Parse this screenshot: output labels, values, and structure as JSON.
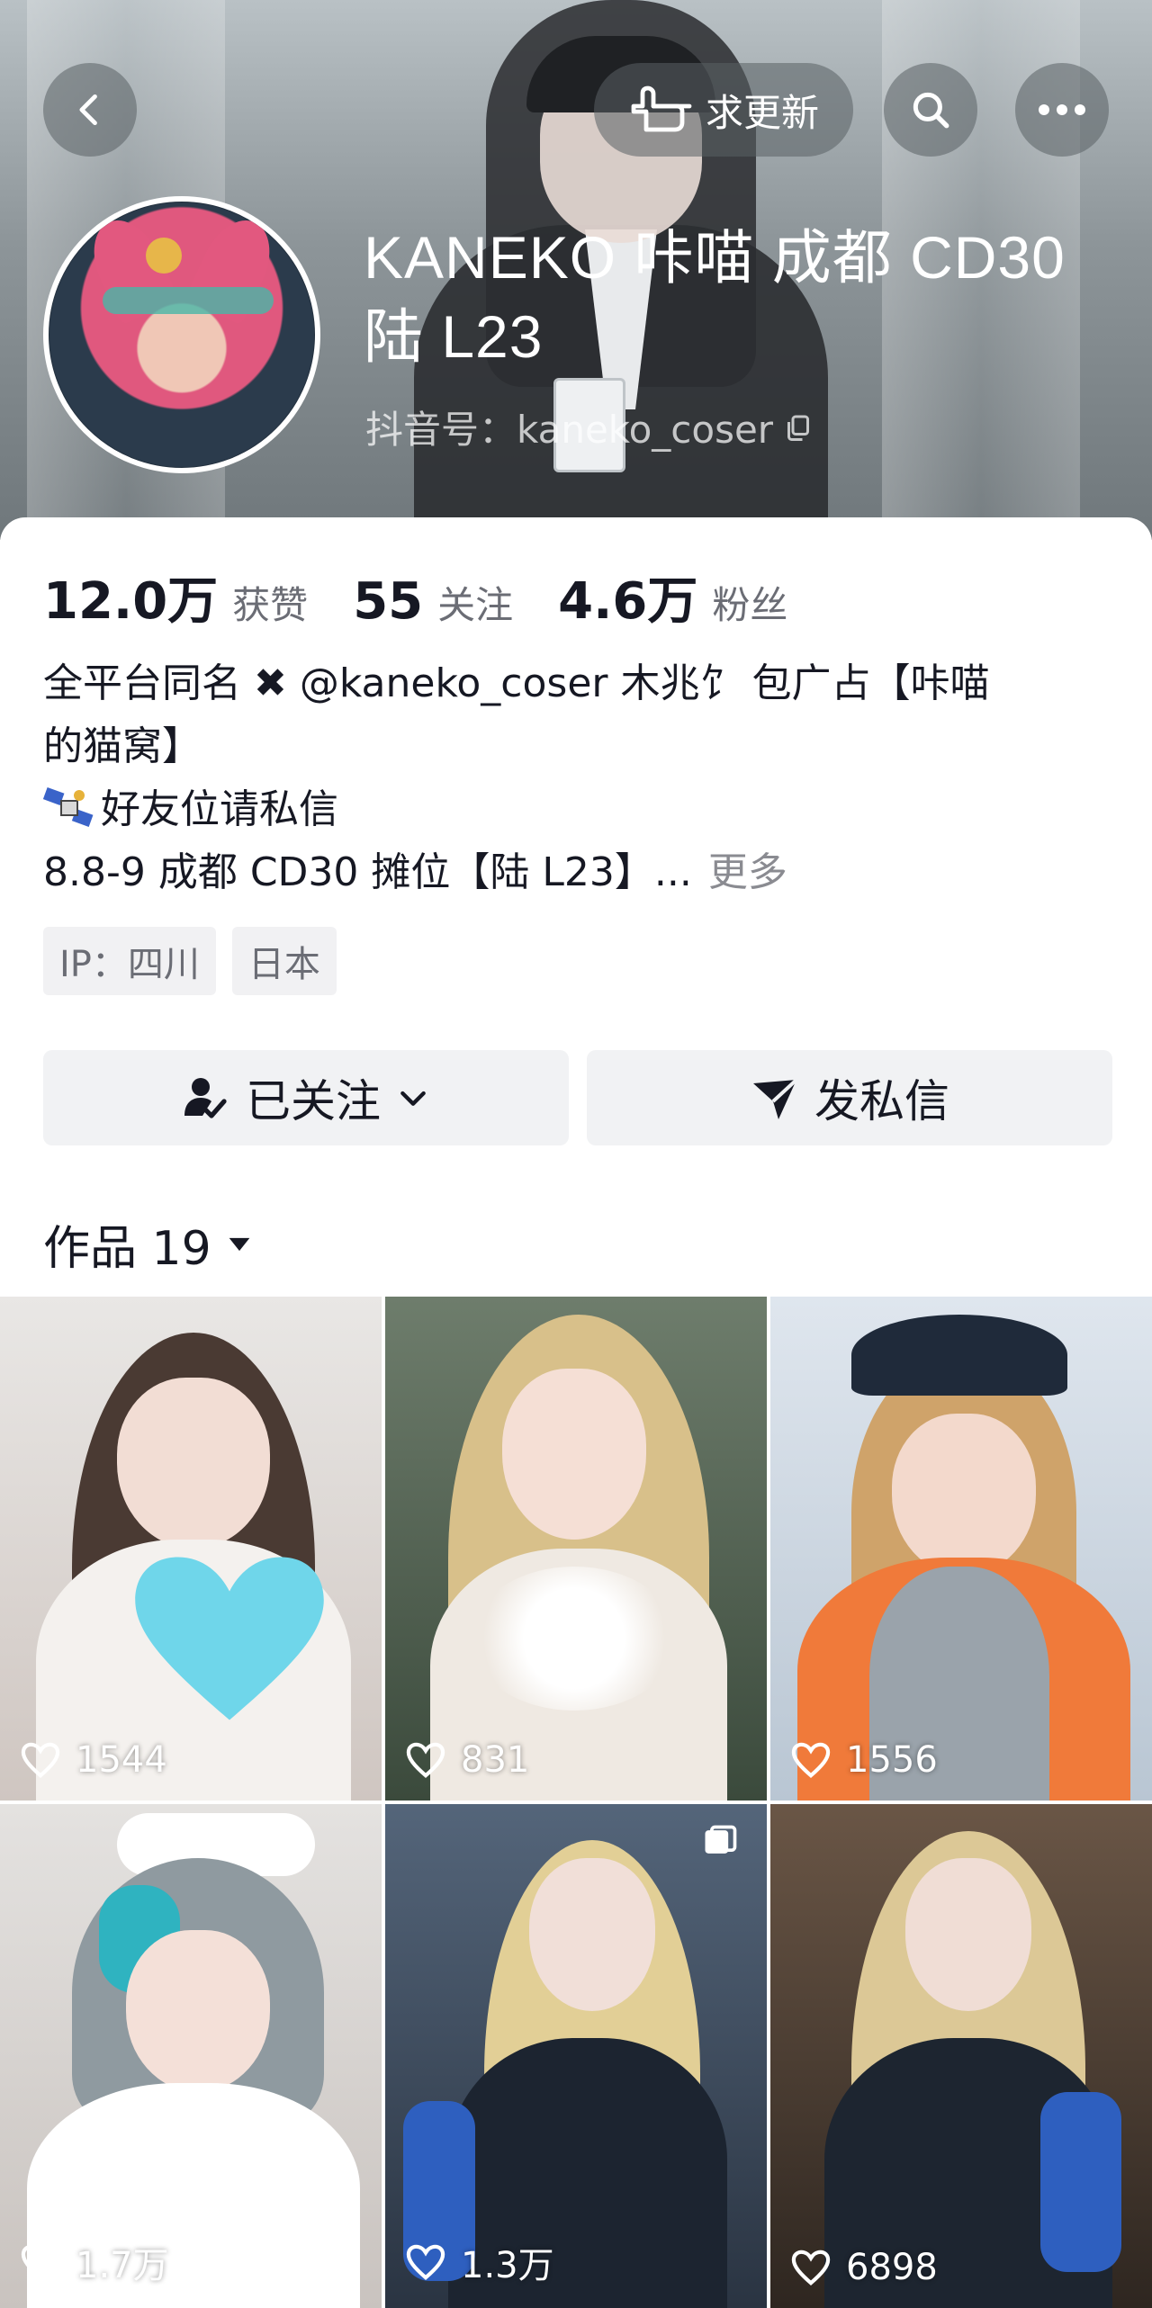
{
  "header": {
    "urge_update_label": "求更新",
    "profile_name": "KANEKO 咔喵 成都 CD30 陆 L23",
    "douyin_id": "抖音号：kaneko_coser"
  },
  "stats": [
    {
      "value": "12.0万",
      "label": "获赞"
    },
    {
      "value": "55",
      "label": "关注"
    },
    {
      "value": "4.6万",
      "label": "粉丝"
    }
  ],
  "bio": {
    "line1": "全平台同名 ✖ @kaneko_coser  木兆饣 包广占【咔喵",
    "line2": "的猫窝】",
    "line3": "好友位请私信",
    "line4": "8.8-9 成都 CD30 摊位【陆 L23】...",
    "more": "更多"
  },
  "tags": [
    "IP：四川",
    "日本"
  ],
  "actions": {
    "follow_label": "已关注",
    "message_label": "发私信"
  },
  "works": {
    "label": "作品 19"
  },
  "grid": [
    {
      "likes": "1544"
    },
    {
      "likes": "831"
    },
    {
      "likes": "1556"
    },
    {
      "likes": "1.7万"
    },
    {
      "likes": "1.3万"
    },
    {
      "likes": "6898"
    }
  ]
}
